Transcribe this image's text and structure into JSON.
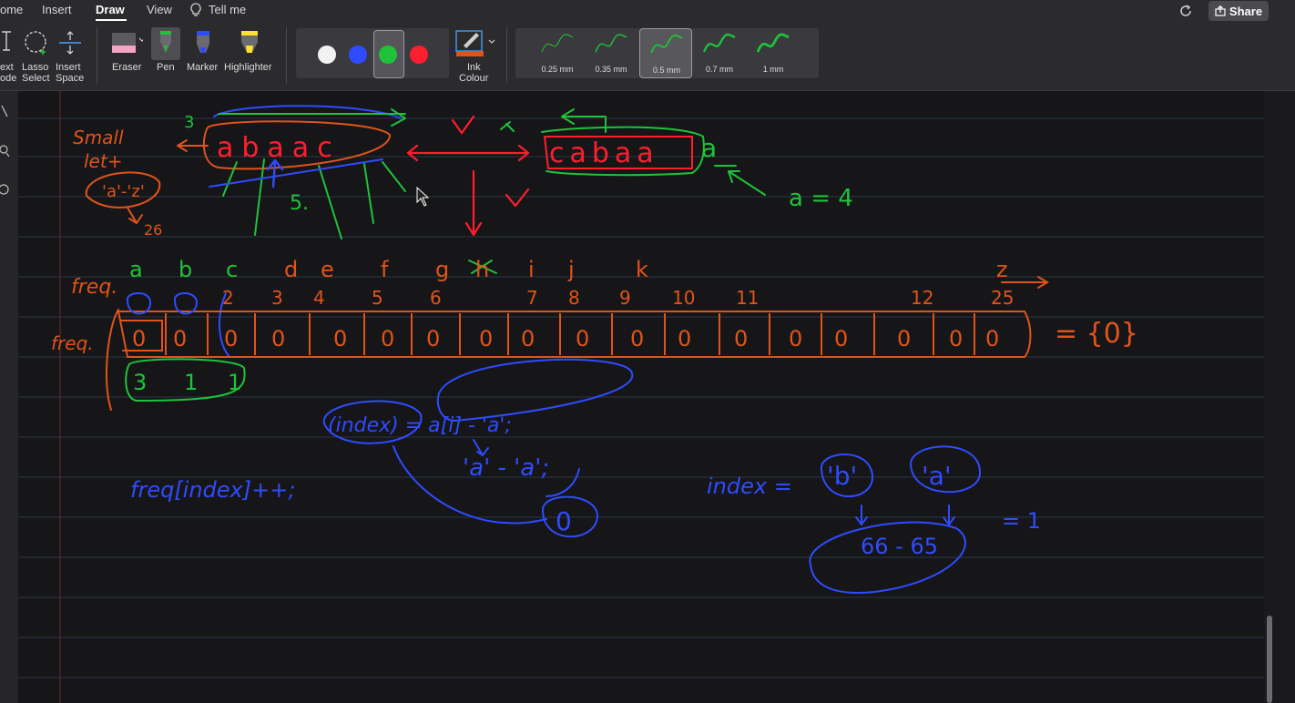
{
  "menu": {
    "home": "ome",
    "insert": "Insert",
    "draw": "Draw",
    "view": "View",
    "tellme": "Tell me",
    "share": "Share"
  },
  "ribbon": {
    "text_mode": [
      "ext",
      "ode"
    ],
    "lasso": [
      "Lasso",
      "Select"
    ],
    "insert_space": [
      "Insert",
      "Space"
    ],
    "eraser": "Eraser",
    "pen": "Pen",
    "marker": "Marker",
    "highlighter": "Highlighter",
    "ink_colour": [
      "Ink",
      "Colour"
    ],
    "colors": [
      "#f2f2f2",
      "#2f4bff",
      "#1fc23a",
      "#ff1e2d"
    ],
    "selected_color_index": 2,
    "thickness": [
      "0.25 mm",
      "0.35 mm",
      "0.5 mm",
      "0.7 mm",
      "1 mm"
    ],
    "selected_thickness_index": 2
  },
  "icons": [
    "lightbulb-icon",
    "sync-icon",
    "share-icon",
    "text-mode-icon",
    "lasso-icon",
    "insert-space-icon",
    "eraser-icon",
    "pen-icon",
    "marker-icon",
    "highlighter-icon",
    "ink-colour-icon"
  ],
  "notes": {
    "top_letters": "abaac",
    "top_result": "cabaa",
    "appended": "a",
    "small_note": [
      "Small",
      "let+"
    ],
    "range_note": "'a'-'z'",
    "count_26": "26",
    "count_3": "3",
    "count_5": "5.",
    "result_a": "a = 4",
    "freq_label": "freq.",
    "freq_letters": [
      "a",
      "b",
      "c",
      "d",
      "e",
      "f",
      "g",
      "h",
      "i",
      "j",
      "k",
      "z"
    ],
    "freq_indices": [
      "2",
      "3",
      "4",
      "5",
      "6",
      "7",
      "8",
      "9",
      "10",
      "11",
      "12",
      "25"
    ],
    "array_values": [
      "0",
      "0",
      "0",
      "0",
      "0",
      "0",
      "0",
      "0",
      "0",
      "0",
      "0",
      "0",
      "0",
      "0",
      "0",
      "0",
      "0",
      "0"
    ],
    "init_text": "= {0}",
    "counts": [
      "3",
      "1",
      "1"
    ],
    "index_expr": "(index) = a[i] - 'a';",
    "char_expr": "'a' - 'a';",
    "freq_increment": "freq[index]++;",
    "zero": "0",
    "index_eq": "index =",
    "char_b": "'b'",
    "char_a": "'a'",
    "calc": "66 - 65",
    "calc_result": "= 1"
  }
}
